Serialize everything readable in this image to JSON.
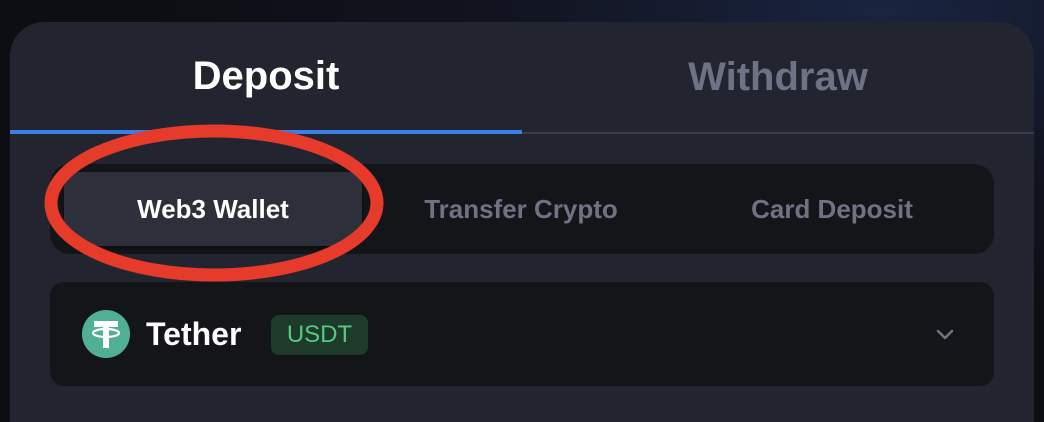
{
  "tabs": [
    {
      "label": "Deposit",
      "active": true
    },
    {
      "label": "Withdraw",
      "active": false
    }
  ],
  "methods": [
    {
      "label": "Web3 Wallet",
      "active": true
    },
    {
      "label": "Transfer Crypto",
      "active": false
    },
    {
      "label": "Card Deposit",
      "active": false
    }
  ],
  "coin": {
    "name": "Tether",
    "symbol": "USDT",
    "icon": "tether-icon"
  },
  "colors": {
    "accent": "#3a7ee6",
    "annotation": "#e63a2a",
    "tether": "#50af95",
    "badge_text": "#55c97f"
  }
}
